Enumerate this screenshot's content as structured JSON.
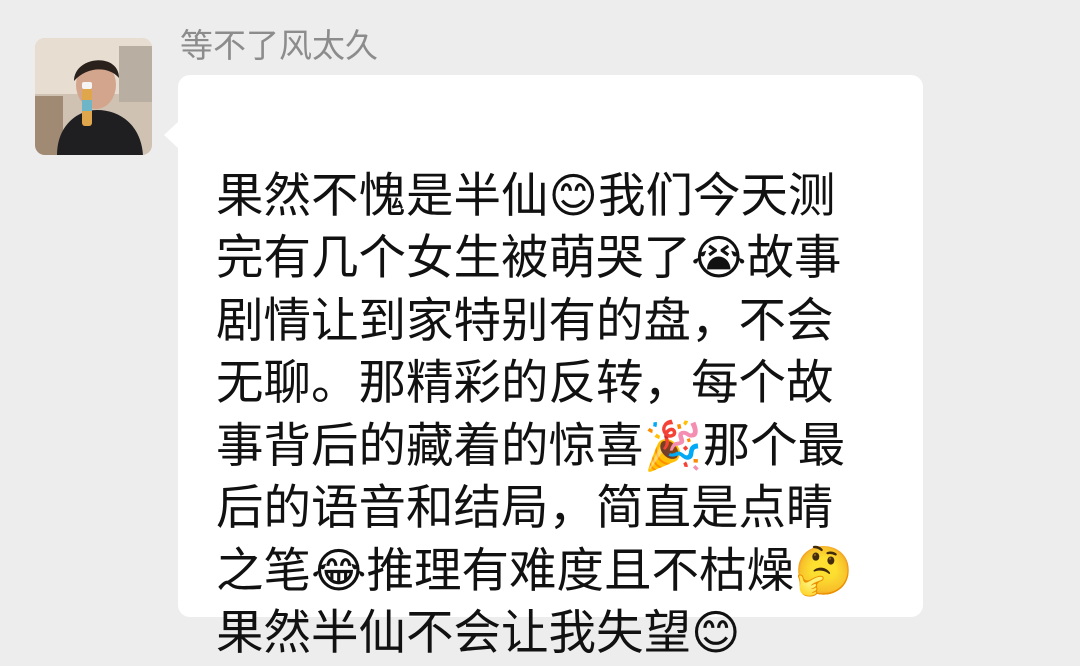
{
  "message": {
    "sender_name": "等不了风太久",
    "avatar": "user-avatar-photo",
    "text_lines": [
      "果然不愧是半仙😊我们今天测",
      "完有几个女生被萌哭了😭故事",
      "剧情让到家特别有的盘，不会",
      "无聊。那精彩的反转，每个故",
      "事背后的藏着的惊喜🎉那个最",
      "后的语音和结局，简直是点睛",
      "之笔😂推理有难度且不枯燥🤔",
      "果然半仙不会让我失望😊"
    ]
  },
  "colors": {
    "background": "#ededed",
    "bubble": "#ffffff",
    "sender_name": "#8c8c8c",
    "message_text": "#111111"
  }
}
